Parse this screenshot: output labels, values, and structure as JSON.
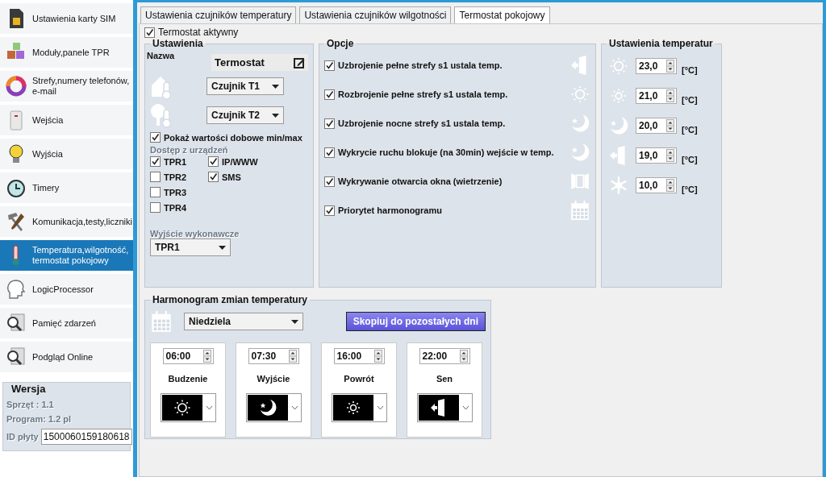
{
  "sidebar": {
    "items": [
      {
        "label": "Ustawienia karty SIM",
        "selected": false
      },
      {
        "label": "Moduły,panele TPR",
        "selected": false
      },
      {
        "label": "Strefy,numery telefonów, e-mail",
        "selected": false
      },
      {
        "label": "Wejścia",
        "selected": false
      },
      {
        "label": "Wyjścia",
        "selected": false
      },
      {
        "label": "Timery",
        "selected": false
      },
      {
        "label": "Komunikacja,testy,liczniki",
        "selected": false
      },
      {
        "label": "Temperatura,wilgotność, termostat pokojowy",
        "selected": true
      },
      {
        "label": "LogicProcessor",
        "selected": false
      },
      {
        "label": "Pamięć zdarzeń",
        "selected": false
      },
      {
        "label": "Podgląd Online",
        "selected": false
      }
    ],
    "version": {
      "title": "Wersja",
      "hardware": "Sprzęt : 1.1",
      "program": "Program: 1.2 pl",
      "board_id_label": "ID płyty",
      "board_id": "1500060159180618"
    }
  },
  "tabs": [
    {
      "label": "Ustawienia czujników temperatury",
      "selected": false
    },
    {
      "label": "Ustawienia czujników wilgotności",
      "selected": false
    },
    {
      "label": "Termostat pokojowy",
      "selected": true
    }
  ],
  "thermostat_active": {
    "label": "Termostat aktywny",
    "checked": true
  },
  "settings": {
    "title": "Ustawienia",
    "name_label": "Nazwa",
    "name_value": "Termostat",
    "sensor_inside": "Czujnik T1",
    "sensor_outside": "Czujnik T2",
    "show_minmax": {
      "label": "Pokaż wartości dobowe min/max",
      "checked": true
    },
    "access_title": "Dostęp z urządzeń",
    "access": [
      {
        "label": "TPR1",
        "checked": true
      },
      {
        "label": "TPR2",
        "checked": false
      },
      {
        "label": "TPR3",
        "checked": false
      },
      {
        "label": "TPR4",
        "checked": false
      },
      {
        "label": "IP/WWW",
        "checked": true
      },
      {
        "label": "SMS",
        "checked": true
      }
    ],
    "output_title": "Wyjście wykonawcze",
    "output_value": "TPR1"
  },
  "options": {
    "title": "Opcje",
    "items": [
      {
        "label": "Uzbrojenie pełne strefy s1 ustala temp.",
        "checked": true
      },
      {
        "label": "Rozbrojenie pełne strefy s1 ustala temp.",
        "checked": true
      },
      {
        "label": "Uzbrojenie nocne strefy s1 ustala temp.",
        "checked": true
      },
      {
        "label": "Wykrycie ruchu blokuje (na 30min) wejście w temp.",
        "checked": true
      },
      {
        "label": "Wykrywanie otwarcia okna (wietrzenie)",
        "checked": true
      },
      {
        "label": "Priorytet harmonogramu",
        "checked": true
      }
    ]
  },
  "temperatures": {
    "title": "Ustawienia temperatur",
    "items": [
      {
        "value": "23,0",
        "unit": "[°C]"
      },
      {
        "value": "21,0",
        "unit": "[°C]"
      },
      {
        "value": "20,0",
        "unit": "[°C]"
      },
      {
        "value": "19,0",
        "unit": "[°C]"
      },
      {
        "value": "10,0",
        "unit": "[°C]"
      }
    ]
  },
  "schedule": {
    "title": "Harmonogram zmian temperatury",
    "day": "Niedziela",
    "copy_button": "Skopiuj do pozostałych dni",
    "slots": [
      {
        "time": "06:00",
        "label": "Budzenie",
        "kind": "sun"
      },
      {
        "time": "07:30",
        "label": "Wyjście",
        "kind": "moon"
      },
      {
        "time": "16:00",
        "label": "Powrót",
        "kind": "sun_small"
      },
      {
        "time": "22:00",
        "label": "Sen",
        "kind": "door"
      }
    ]
  }
}
